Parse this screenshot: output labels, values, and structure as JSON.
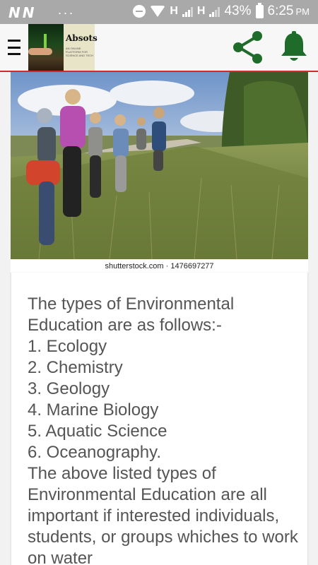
{
  "status_bar": {
    "notif_icons": [
      "N",
      "N"
    ],
    "overflow": "···",
    "net_type_1": "H",
    "net_type_2": "H",
    "battery": "43%",
    "time": "6:25",
    "ampm": "PM"
  },
  "app_bar": {
    "logo_title": "Absots",
    "logo_subtitle": "AN ONLINE PLATFORM FOR SCIENCE AND TECH",
    "accent_color": "#d9262a",
    "icon_color": "#1f6b2a"
  },
  "image": {
    "caption": "shutterstock.com · 1476697277"
  },
  "article": {
    "paragraph": "The types of Environmental Education are as follows:-",
    "list": [
      "1. Ecology",
      "2. Chemistry",
      "3. Geology",
      "4. Marine Biology",
      "5. Aquatic Science",
      "6. Oceanography."
    ],
    "paragraph_2": "The above listed types of Environmental Education are all important if interested individuals, students, or groups whiches to work on water"
  }
}
